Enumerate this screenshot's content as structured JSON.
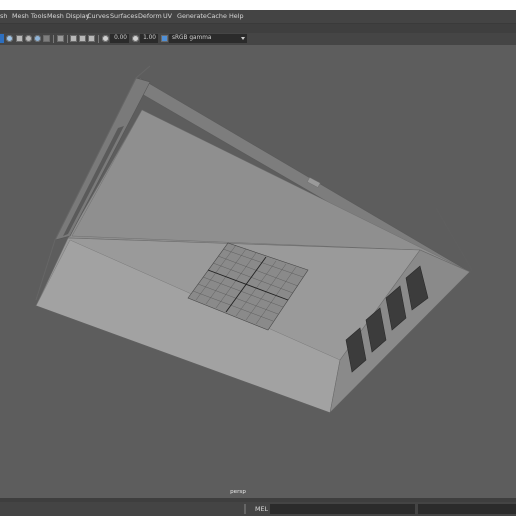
{
  "menubar": {
    "items": [
      "sh",
      "Mesh Tools",
      "Mesh Display",
      "Curves",
      "Surfaces",
      "Deform",
      "UV",
      "Generate",
      "Cache",
      "Help"
    ]
  },
  "toolbar": {
    "field1_value": "0.00",
    "field2_value": "1.00",
    "color_space": "sRGB gamma",
    "icons": [
      "select-object-icon",
      "wireframe-icon",
      "shaded-icon",
      "textured-icon",
      "lights-icon",
      "camera-icon",
      "grid-icon",
      "isolate-icon",
      "xray-icon",
      "exposure-icon",
      "gamma-icon",
      "color-management-icon"
    ]
  },
  "viewport": {
    "camera_label": "persp"
  },
  "command_line": {
    "language_label": "MEL"
  },
  "colors": {
    "viewport_bg": "#5d5d5d",
    "ui_dark": "#444444",
    "accent_blue": "#2d6fbf"
  }
}
